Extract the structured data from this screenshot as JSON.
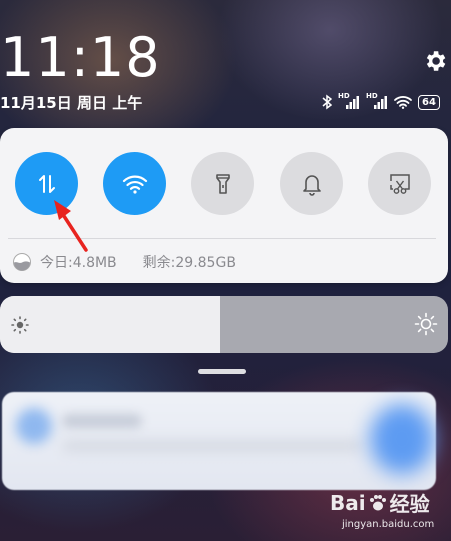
{
  "statusbar": {
    "time": "11:18",
    "date": "11月15日 周日 上午",
    "signal1": "HD",
    "signal2": "HD",
    "battery": "64"
  },
  "quick_toggles": [
    {
      "name": "mobile-data",
      "icon": "data-arrows-icon",
      "state": "on"
    },
    {
      "name": "wifi",
      "icon": "wifi-icon",
      "state": "on"
    },
    {
      "name": "flashlight",
      "icon": "flashlight-icon",
      "state": "off"
    },
    {
      "name": "ring",
      "icon": "bell-icon",
      "state": "off"
    },
    {
      "name": "screenshot",
      "icon": "screenshot-scissors-icon",
      "state": "off"
    }
  ],
  "data_usage": {
    "today": "今日:4.8MB",
    "remaining": "剩余:29.85GB"
  },
  "brightness": {
    "level": 0.49
  },
  "watermark": {
    "logo_text": "Bai",
    "logo_suffix": "经验",
    "url": "jingyan.baidu.com"
  },
  "colors": {
    "accent": "#1e9bf5",
    "annotation_arrow": "#e8231f"
  }
}
